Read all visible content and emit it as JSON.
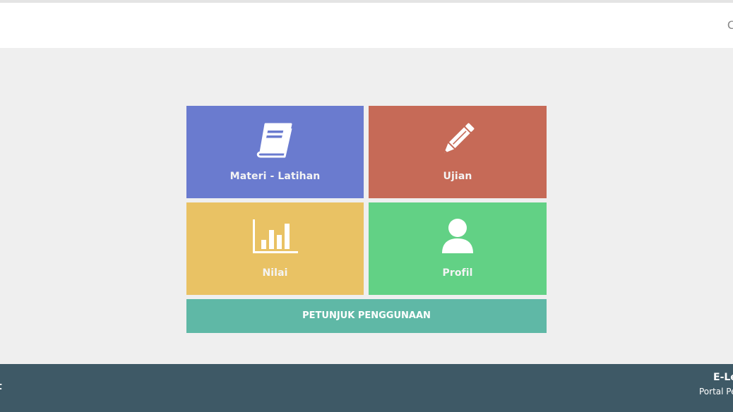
{
  "header": {
    "right_glyph": "C"
  },
  "menu": {
    "materi": {
      "label": "Materi - Latihan",
      "icon": "book-icon",
      "color": "#6a7bcf"
    },
    "ujian": {
      "label": "Ujian",
      "icon": "pencil-icon",
      "color": "#c66a57"
    },
    "nilai": {
      "label": "Nilai",
      "icon": "bar-chart-icon",
      "color": "#e9c264"
    },
    "profil": {
      "label": "Profil",
      "icon": "user-icon",
      "color": "#62d185"
    }
  },
  "guide_button": {
    "label": "PETUNJUK PENGGUNAAN",
    "color": "#5fb8a6"
  },
  "footer": {
    "left_text": "t",
    "right_title": "E-Le",
    "right_subtitle": "Portal Pe",
    "background": "#3e5966"
  }
}
